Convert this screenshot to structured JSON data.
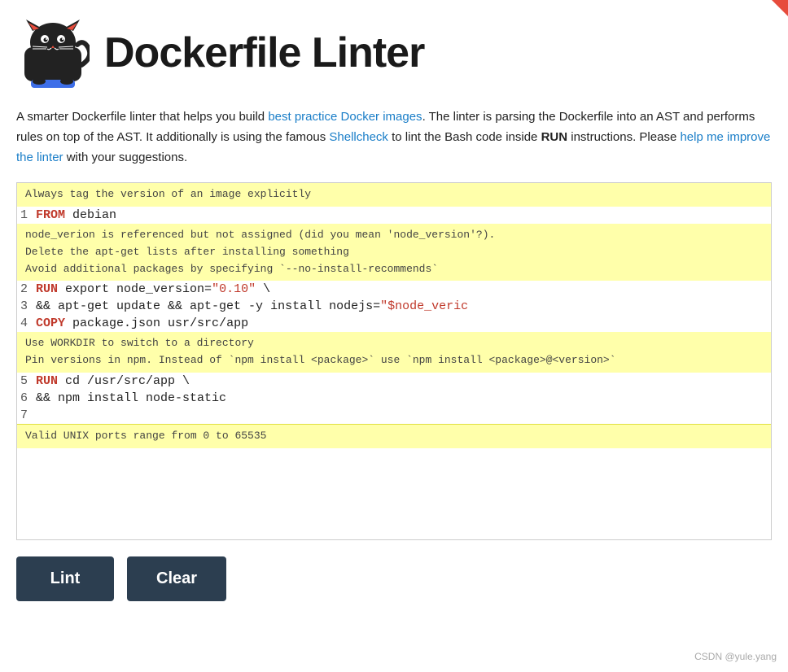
{
  "header": {
    "title": "Dockerfile Linter"
  },
  "description": {
    "part1": "A smarter Dockerfile linter that helps you build ",
    "link1_text": "best practice Docker images",
    "part2": ". The linter is parsing the Dockerfile into an AST and performs rules on top of the AST. It additionally is using the famous ",
    "link2_text": "Shellcheck",
    "part3": " to lint the Bash code inside ",
    "strong1": "RUN",
    "part4": " instructions. Please ",
    "link3_text": "help me improve the linter",
    "part5": " with your suggestions."
  },
  "lint_messages": {
    "block1": [
      "Always tag the version of an image explicitly"
    ],
    "block2": [
      "node_verion is referenced but not assigned (did you mean 'node_version'?).",
      "Delete the apt-get lists after installing something",
      "Avoid additional packages by specifying `--no-install-recommends`"
    ],
    "block3": [
      "Use WORKDIR to switch to a directory",
      "Pin versions in npm. Instead of `npm install <package>` use `npm install <package>@<version>`"
    ],
    "block4": [
      "Valid UNIX ports range from 0 to 65535"
    ]
  },
  "code_lines": [
    {
      "num": "1",
      "content": "FROM debian",
      "kw": "FROM",
      "rest": " debian"
    },
    {
      "num": "2",
      "content": "RUN export node_version=\"0.10\" \\",
      "kw": "RUN",
      "rest": " export node_version=",
      "str": "\"0.10\"",
      "tail": " \\"
    },
    {
      "num": "3",
      "content": "&& apt-get update && apt-get -y install nodejs=\"$node_veric"
    },
    {
      "num": "4",
      "content": "COPY package.json usr/src/app",
      "kw": "COPY",
      "rest": " package.json usr/src/app"
    },
    {
      "num": "5",
      "content": "RUN cd /usr/src/app \\",
      "kw": "RUN",
      "rest": " cd /usr/src/app \\"
    },
    {
      "num": "6",
      "content": "&& npm install node-static"
    },
    {
      "num": "7",
      "content": ""
    }
  ],
  "buttons": {
    "lint_label": "Lint",
    "clear_label": "Clear"
  },
  "watermark": "CSDN @yule.yang"
}
